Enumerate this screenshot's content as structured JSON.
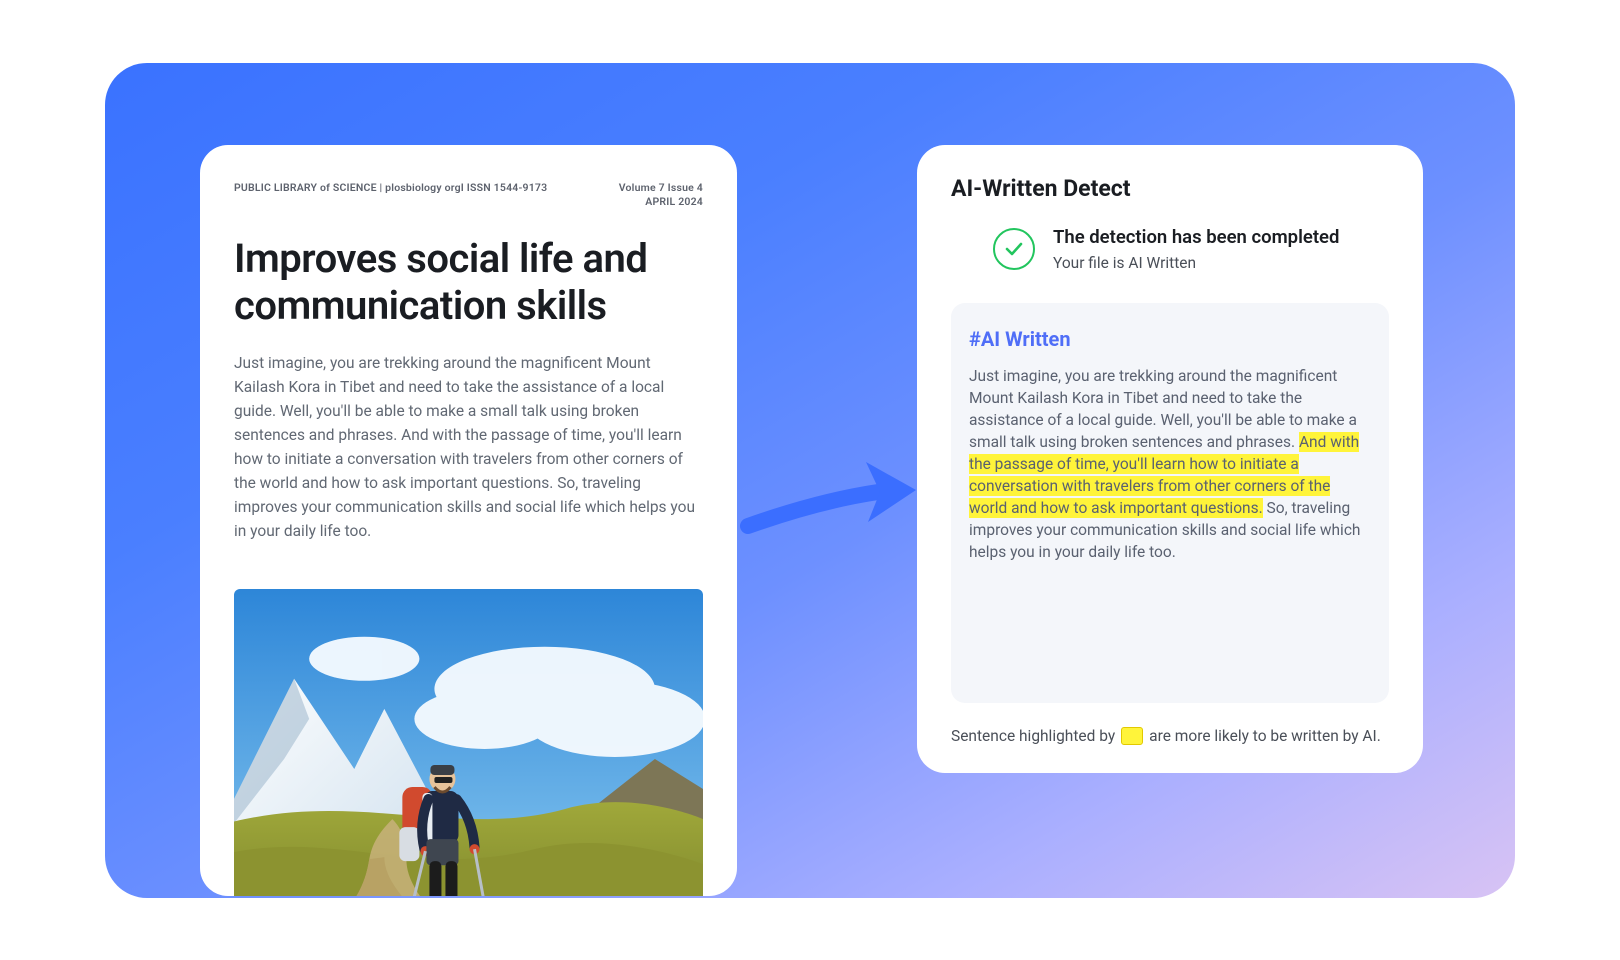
{
  "document": {
    "publisher_line": "PUBLIC LIBRARY of SCIENCE | plosbiology orgI ISSN 1544-9173",
    "volume_issue": "Volume 7 Issue 4",
    "date": "APRIL 2024",
    "title": "Improves social life and communication skills",
    "body": "Just imagine, you are trekking around the magnificent Mount Kailash Kora in Tibet and need to take the assistance of a local guide. Well, you'll be able to make a small talk using broken sentences and phrases. And with the passage of time, you'll learn how to initiate a conversation with travelers from other corners of the world and how to ask important questions. So, traveling improves your communication skills and social life which helps you in your daily life too."
  },
  "detect": {
    "panel_title": "AI-Written Detect",
    "status_main": "The detection has been completed",
    "status_sub": "Your file is AI Written",
    "analysis": {
      "tag": "#AI Written",
      "pre_hl": "Just imagine, you are trekking around the magnificent Mount Kailash Kora in Tibet and need to take the assistance of a local guide. Well, you'll be able to make a small talk using broken sentences and phrases. ",
      "hl": "And with the passage of time, you'll learn how to initiate a conversation with travelers from other corners of the world and how to ask important questions.",
      "post_hl": " So, traveling improves your communication skills and social life which helps you in your daily life too."
    },
    "legend_pre": "Sentence highlighted by",
    "legend_post": "are more likely to be written by AI."
  }
}
